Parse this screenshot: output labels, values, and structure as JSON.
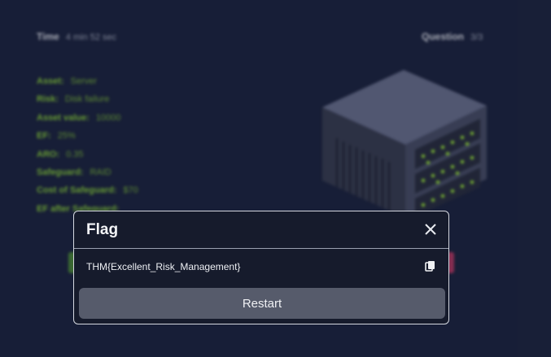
{
  "header": {
    "time_label": "Time",
    "time_value": "4 min 52 sec",
    "question_label": "Question",
    "question_value": "3/3"
  },
  "facts": [
    {
      "key": "Asset:",
      "value": "Server"
    },
    {
      "key": "Risk:",
      "value": "Disk failure"
    },
    {
      "key": "Asset value:",
      "value": "10000"
    },
    {
      "key": "EF:",
      "value": "25%"
    },
    {
      "key": "ARO:",
      "value": "0.35"
    },
    {
      "key": "Safeguard:",
      "value": "RAID"
    },
    {
      "key": "Cost of Safeguard:",
      "value": "$70"
    },
    {
      "key": "EF after Safeguard:",
      "value": ""
    }
  ],
  "modal": {
    "title": "Flag",
    "flag": "THM{Excellent_Risk_Management}",
    "restart_label": "Restart"
  },
  "icons": {
    "close": "close-icon",
    "copy": "copy-icon",
    "illustration": "server-rack-illustration"
  },
  "colors": {
    "background": "#1d2540",
    "fact_text": "#8bd13a",
    "modal_bg": "#161b2c",
    "button": "#565b6b"
  }
}
